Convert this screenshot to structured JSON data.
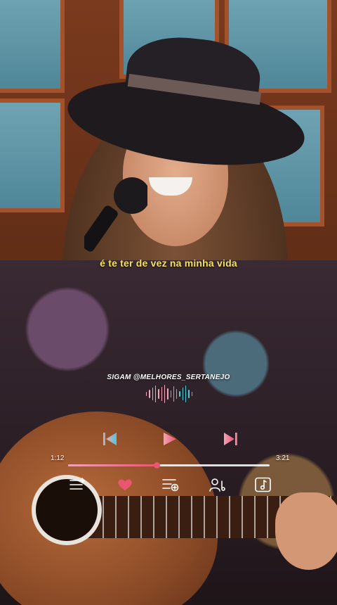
{
  "lyric": "é te ter de vez na minha vida",
  "handle": "SIGAM @MELHORES_SERTANEJO",
  "player": {
    "elapsed": "1:12",
    "duration": "3:21",
    "progress": 0.44
  },
  "icons": {
    "previous": "skip-previous-icon",
    "play": "play-icon",
    "next": "skip-next-icon",
    "queue": "queue-list-icon",
    "like": "heart-icon",
    "add_to_playlist": "playlist-add-icon",
    "artist": "artist-icon",
    "lyrics": "music-note-icon"
  },
  "colors": {
    "lyric": "#f6e05a",
    "accent": "#e8576f",
    "accent_light": "#f3a2b8",
    "eq_start": "#f3a2b8",
    "eq_end": "#4fc9d6"
  }
}
